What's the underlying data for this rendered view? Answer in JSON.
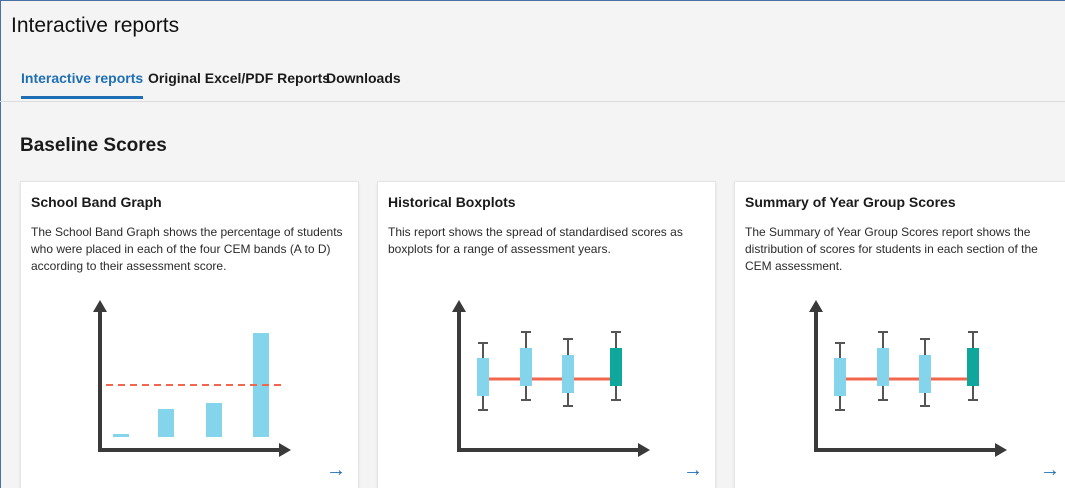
{
  "page": {
    "title": "Interactive reports"
  },
  "tabs": [
    {
      "label": "Interactive reports",
      "active": true
    },
    {
      "label": "Original Excel/PDF Reports",
      "active": false
    },
    {
      "label": "Downloads",
      "active": false
    }
  ],
  "section": {
    "title": "Baseline Scores"
  },
  "cards": [
    {
      "title": "School Band Graph",
      "description": "The School Band Graph shows the percentage of students who were placed in each of the four CEM bands (A to D) according to their assessment score.",
      "icon": "bar-chart-illustration",
      "arrow": "→"
    },
    {
      "title": "Historical Boxplots",
      "description": "This report shows the spread of standardised scores as boxplots for a range of assessment years.",
      "icon": "boxplot-illustration",
      "arrow": "→"
    },
    {
      "title": "Summary of Year Group Scores",
      "description": "The Summary of Year Group Scores report shows the distribution of scores for students in each section of the CEM assessment.",
      "icon": "boxplot-illustration",
      "arrow": "→"
    }
  ],
  "colors": {
    "accent": "#1f6fb5",
    "light_bar": "#84d4ec",
    "dark_bar": "#0fa79c",
    "line": "#f0674e",
    "axis": "#3a3a3a"
  }
}
